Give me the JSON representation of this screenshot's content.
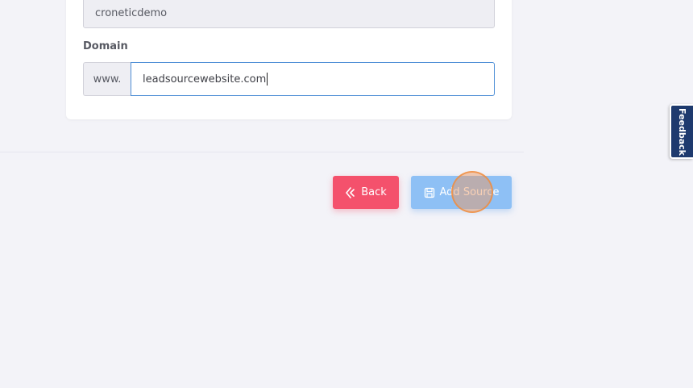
{
  "form": {
    "readonly_value": "croneticdemo",
    "domain_label": "Domain",
    "domain_prefix": "www.",
    "domain_value": "leadsourcewebsite.com"
  },
  "actions": {
    "back_label": "Back",
    "add_label": "Add Source"
  },
  "feedback": {
    "label": "Feedback"
  },
  "colors": {
    "back_button": "#f4516c",
    "add_button": "#8ec0f5",
    "feedback_tab": "#1e3a6e",
    "input_focus_border": "#4f8fd6",
    "page_background": "#f3f3f8"
  },
  "icons": {
    "back": "chevron-left-icon",
    "add": "save-icon"
  }
}
